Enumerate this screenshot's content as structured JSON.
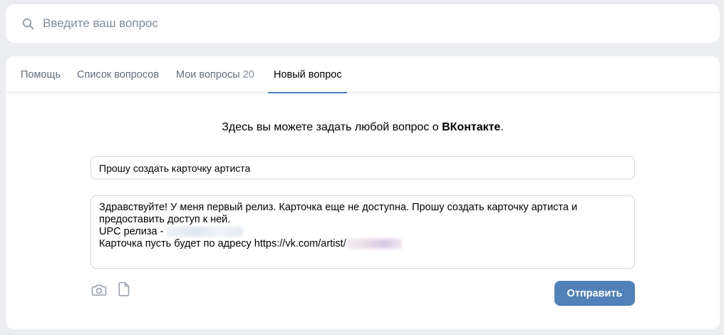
{
  "search": {
    "placeholder": "Введите ваш вопрос"
  },
  "tabs": [
    {
      "label": "Помощь",
      "count": ""
    },
    {
      "label": "Список вопросов",
      "count": ""
    },
    {
      "label": "Мои вопросы",
      "count": "20"
    },
    {
      "label": "Новый вопрос",
      "count": ""
    }
  ],
  "active_tab": "Новый вопрос",
  "intro": {
    "text_before": "Здесь вы можете задать любой вопрос о ",
    "brand": "ВКонтакте",
    "text_after": "."
  },
  "form": {
    "subject_value": "Прошу создать карточку артиста",
    "message_lines": [
      "Здравствуйте! У меня первый релиз. Карточка еще не доступна. Прошу создать карточку артиста и",
      "предоставить доступ к ней.",
      "UPC релиза - ",
      "Карточка пусть будет по адресу https://vk.com/artist/"
    ],
    "send_label": "Отправить"
  },
  "icons": {
    "search": "search-icon",
    "camera": "camera-icon",
    "document": "document-icon"
  },
  "colors": {
    "accent": "#5181b8",
    "background": "#ebedf0",
    "muted_text": "#626d7a"
  }
}
